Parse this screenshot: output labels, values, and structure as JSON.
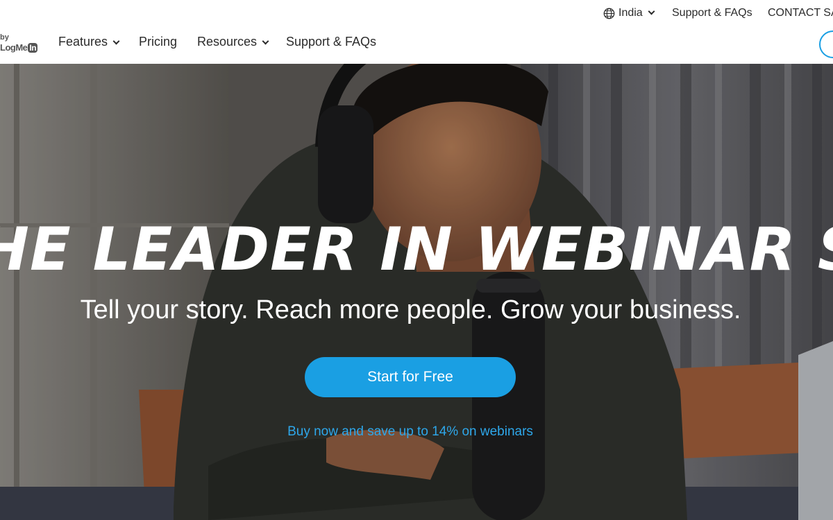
{
  "utility_bar": {
    "language": "India",
    "support": "Support & FAQs",
    "contact": "CONTACT SA"
  },
  "main_nav": {
    "logo_by": "by",
    "logo_brand": "LogMe",
    "logo_badge": "In",
    "items": [
      {
        "label": "Features",
        "has_dropdown": true
      },
      {
        "label": "Pricing",
        "has_dropdown": false
      },
      {
        "label": "Resources",
        "has_dropdown": true
      },
      {
        "label": "Support & FAQs",
        "has_dropdown": false
      }
    ]
  },
  "hero": {
    "title": "HE LEADER IN WEBINAR SOFTWAR",
    "subtitle": "Tell your story. Reach more people. Grow your business.",
    "cta_label": "Start for Free",
    "promo_text": "Buy now and save up to 14% on webinars"
  },
  "colors": {
    "accent": "#1a9fe3",
    "link": "#2ea7ea",
    "text": "#2b2b2b"
  }
}
